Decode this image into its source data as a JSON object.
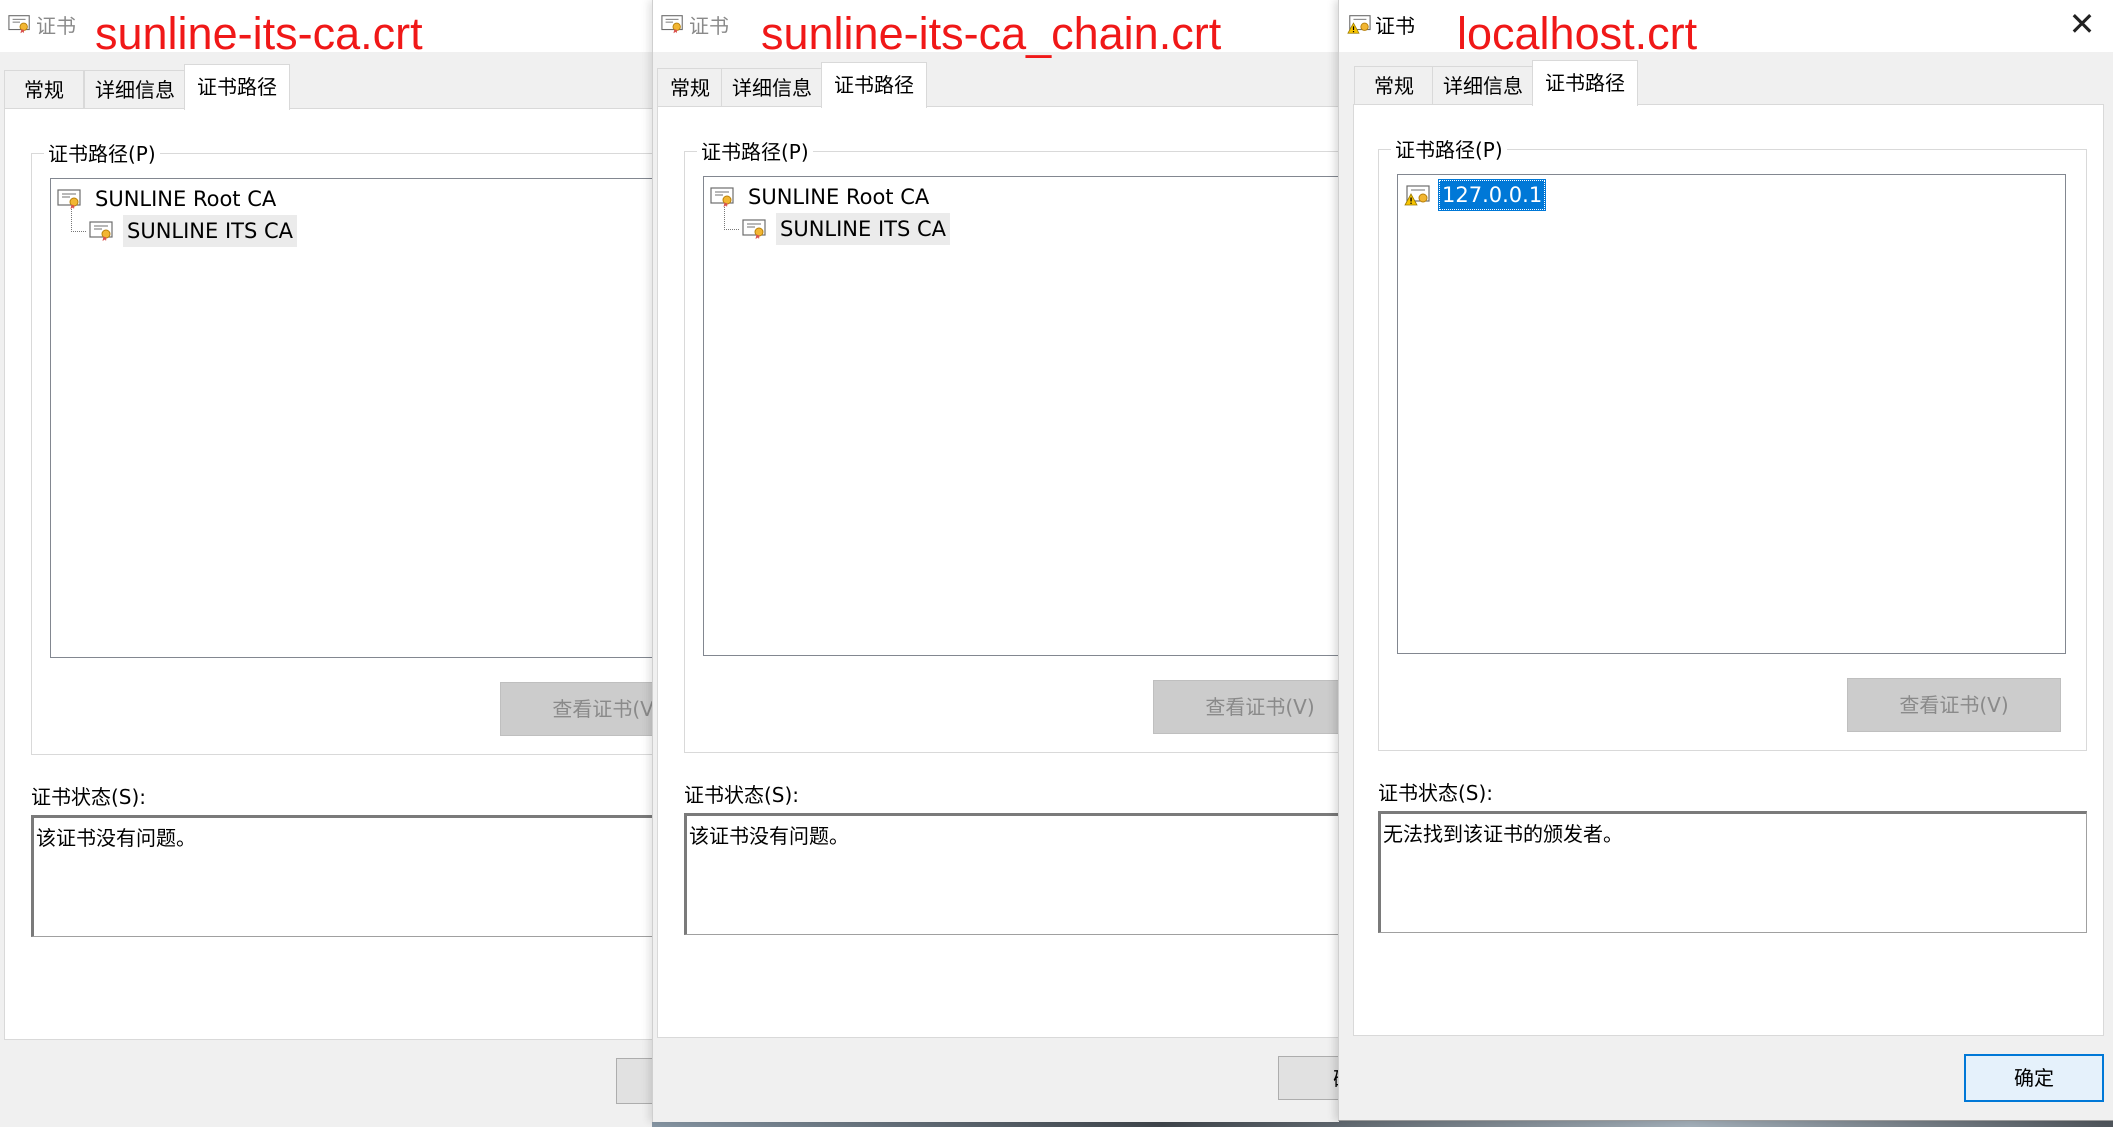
{
  "windows": [
    {
      "title": "证书",
      "annotation": "sunline-its-ca.crt",
      "tabs": [
        {
          "label": "常规"
        },
        {
          "label": "详细信息"
        },
        {
          "label": "证书路径"
        }
      ],
      "active_tab": "证书路径",
      "path_group_label": "证书路径(P)",
      "tree": [
        {
          "label": "SUNLINE Root CA",
          "level": 0,
          "icon": "certificate-icon"
        },
        {
          "label": "SUNLINE ITS CA",
          "level": 1,
          "icon": "certificate-icon",
          "selected": true
        }
      ],
      "view_button_label": "查看证书(V)",
      "status_label": "证书状态(S):",
      "status_text": "该证书没有问题。",
      "ok_button_label": ""
    },
    {
      "title": "证书",
      "annotation": "sunline-its-ca_chain.crt",
      "tabs": [
        {
          "label": "常规"
        },
        {
          "label": "详细信息"
        },
        {
          "label": "证书路径"
        }
      ],
      "active_tab": "证书路径",
      "path_group_label": "证书路径(P)",
      "tree": [
        {
          "label": "SUNLINE Root CA",
          "level": 0,
          "icon": "certificate-icon"
        },
        {
          "label": "SUNLINE ITS CA",
          "level": 1,
          "icon": "certificate-icon",
          "selected": true
        }
      ],
      "view_button_label": "查看证书(V)",
      "status_label": "证书状态(S):",
      "status_text": "该证书没有问题。",
      "ok_button_label": "确"
    },
    {
      "title": "证书",
      "annotation": "localhost.crt",
      "tabs": [
        {
          "label": "常规"
        },
        {
          "label": "详细信息"
        },
        {
          "label": "证书路径"
        }
      ],
      "active_tab": "证书路径",
      "path_group_label": "证书路径(P)",
      "tree": [
        {
          "label": "127.0.0.1",
          "level": 0,
          "icon": "certificate-warning-icon",
          "highlighted": true
        }
      ],
      "view_button_label": "查看证书(V)",
      "status_label": "证书状态(S):",
      "status_text": "无法找到该证书的颁发者。",
      "ok_button_label": "确定",
      "close_icon": "close-icon"
    }
  ],
  "colors": {
    "annotation": "#f01818",
    "selection": "#0078d7",
    "window_bg": "#f0f0f0",
    "disabled_button": "#cccccc"
  }
}
